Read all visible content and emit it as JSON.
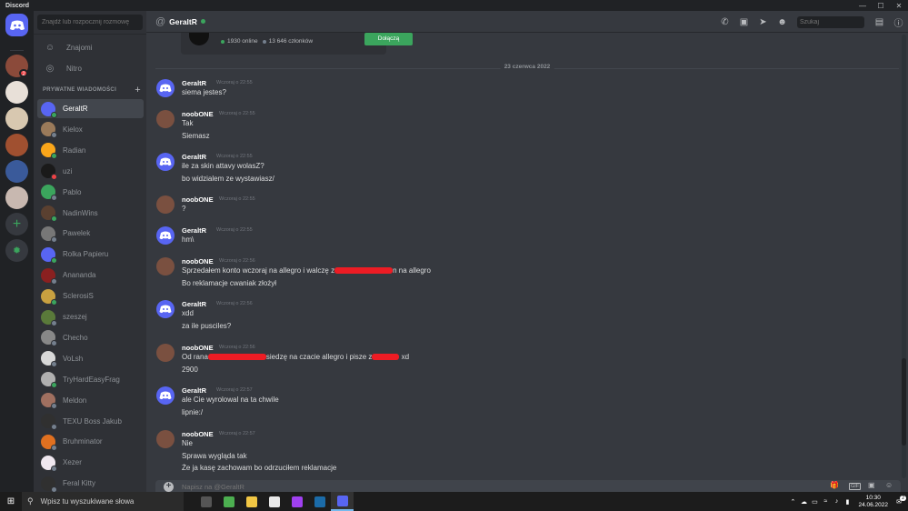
{
  "window": {
    "app_name": "Discord",
    "controls": [
      "—",
      "☐",
      "✕"
    ]
  },
  "guilds": {
    "home_label": "Strona główna",
    "mention_badge": "2",
    "colors": [
      "#8b4a3a",
      "#e8e0d8",
      "#d8c8b0",
      "#a05030",
      "#3a5a9a",
      "#c8b8b0"
    ]
  },
  "dm_sidebar": {
    "search_placeholder": "Znajdź lub rozpocznij rozmowę",
    "nav": [
      {
        "label": "Znajomi",
        "icon": "friends-icon",
        "glyph": "☺"
      },
      {
        "label": "Nitro",
        "icon": "nitro-icon",
        "glyph": "◎"
      }
    ],
    "section_title": "PRYWATNE WIADOMOŚCI",
    "items": [
      {
        "name": "GeraltR",
        "color": "#5865f2",
        "status": "on"
      },
      {
        "name": "Kielox",
        "color": "#9a7a5a",
        "status": "off"
      },
      {
        "name": "Radian",
        "color": "#faa61a",
        "status": "on"
      },
      {
        "name": "uzi",
        "color": "#1a1a1a",
        "status": "dnd"
      },
      {
        "name": "Pablo",
        "color": "#3ba55d",
        "status": "off"
      },
      {
        "name": "NadinWins",
        "color": "#5a4030",
        "status": "on"
      },
      {
        "name": "Pawelek",
        "color": "#777777",
        "status": "off"
      },
      {
        "name": "Rolka Papieru",
        "color": "#5865f2",
        "status": "on"
      },
      {
        "name": "Anananda",
        "color": "#8a2020",
        "status": "off"
      },
      {
        "name": "SclerosiS",
        "color": "#c8a040",
        "status": "on"
      },
      {
        "name": "szeszej",
        "color": "#5a7a3a",
        "status": "off"
      },
      {
        "name": "Checho",
        "color": "#888888",
        "status": "off"
      },
      {
        "name": "VoLsh",
        "color": "#d8d8d8",
        "status": "off"
      },
      {
        "name": "TryHardEasyFrag",
        "color": "#b0b0b0",
        "status": "on"
      },
      {
        "name": "Meldon",
        "color": "#a07060",
        "status": "off"
      },
      {
        "name": "TEXU Boss Jakub",
        "color": "#303030",
        "status": "off"
      },
      {
        "name": "Bruhminator",
        "color": "#e07020",
        "status": "off"
      },
      {
        "name": "Xezer",
        "color": "#f0e8f0",
        "status": "off"
      },
      {
        "name": "Feral Kitty",
        "color": "#303030",
        "status": "off"
      }
    ]
  },
  "header": {
    "channel": "GeraltR",
    "search_placeholder": "Szukaj",
    "icons": [
      "call-icon",
      "video-icon",
      "pin-icon",
      "add-friend-icon",
      "inbox-icon",
      "help-icon"
    ]
  },
  "invite": {
    "online": "1930 online",
    "members": "13 646 członków",
    "join_label": "Dołączą"
  },
  "chat": {
    "date_divider": "23 czerwca 2022",
    "messages": [
      {
        "author": "GeraltR",
        "time": "Wczoraj o 22:55",
        "avatar": "#5865f2",
        "lines": [
          [
            "siema jestes?"
          ]
        ]
      },
      {
        "author": "noobONE",
        "time": "Wczoraj o 22:55",
        "avatar": "#7a5040",
        "lines": [
          [
            "Tak"
          ],
          [
            "Siemasz"
          ]
        ]
      },
      {
        "author": "GeraltR",
        "time": "Wczoraj o 22:55",
        "avatar": "#5865f2",
        "lines": [
          [
            "ile za skin attavy wolasZ?"
          ],
          [
            "bo widzialem ze wystawiasz/"
          ]
        ]
      },
      {
        "author": "noobONE",
        "time": "Wczoraj o 22:55",
        "avatar": "#7a5040",
        "lines": [
          [
            "?"
          ]
        ]
      },
      {
        "author": "GeraltR",
        "time": "Wczoraj o 22:55",
        "avatar": "#5865f2",
        "lines": [
          [
            "hm\\"
          ]
        ]
      },
      {
        "author": "noobONE",
        "time": "Wczoraj o 22:56",
        "avatar": "#7a5040",
        "lines": [
          [
            "Sprzedałem konto wczoraj na allegro i walczę z",
            "",
            "n na allegro"
          ],
          [
            "Bo reklamacje cwaniak złożył"
          ]
        ]
      },
      {
        "author": "GeraltR",
        "time": "Wczoraj o 22:56",
        "avatar": "#5865f2",
        "lines": [
          [
            "xdd"
          ],
          [
            "za ile pusciles?"
          ]
        ]
      },
      {
        "author": "noobONE",
        "time": "Wczoraj o 22:56",
        "avatar": "#7a5040",
        "lines": [
          [
            "Od rana",
            "",
            "siedzę na czacie allegro i pisze z",
            "",
            " xd"
          ],
          [
            "2900"
          ]
        ]
      },
      {
        "author": "GeraltR",
        "time": "Wczoraj o 22:57",
        "avatar": "#5865f2",
        "lines": [
          [
            "ale Cie wyrolowal na ta chwile"
          ],
          [
            "lipnie:/"
          ]
        ]
      },
      {
        "author": "noobONE",
        "time": "Wczoraj o 22:57",
        "avatar": "#7a5040",
        "lines": [
          [
            "Nie"
          ],
          [
            "Sprawa wygląda tak"
          ],
          [
            "Że ja kasę zachowam bo odrzuciłem reklamacje"
          ]
        ]
      }
    ]
  },
  "composer": {
    "placeholder": "Napisz na @GeraltR",
    "icons": [
      "gift-icon",
      "gif-icon",
      "sticker-icon",
      "emoji-icon"
    ],
    "gif_label": "GIF"
  },
  "taskbar": {
    "search_placeholder": "Wpisz tu wyszukiwane słowa",
    "apps": [
      {
        "icon": "task-view-icon",
        "color": "#555555"
      },
      {
        "icon": "chrome-icon",
        "color": "#4caf50"
      },
      {
        "icon": "file-explorer-icon",
        "color": "#f2c744"
      },
      {
        "icon": "store-icon",
        "color": "#e8e8e8"
      },
      {
        "icon": "messenger-icon",
        "color": "#a040f0"
      },
      {
        "icon": "steam-icon",
        "color": "#1b6ba8"
      },
      {
        "icon": "discord-icon",
        "color": "#5865f2"
      }
    ],
    "time": "10:30",
    "date": "24.06.2022",
    "notification_count": "2"
  }
}
